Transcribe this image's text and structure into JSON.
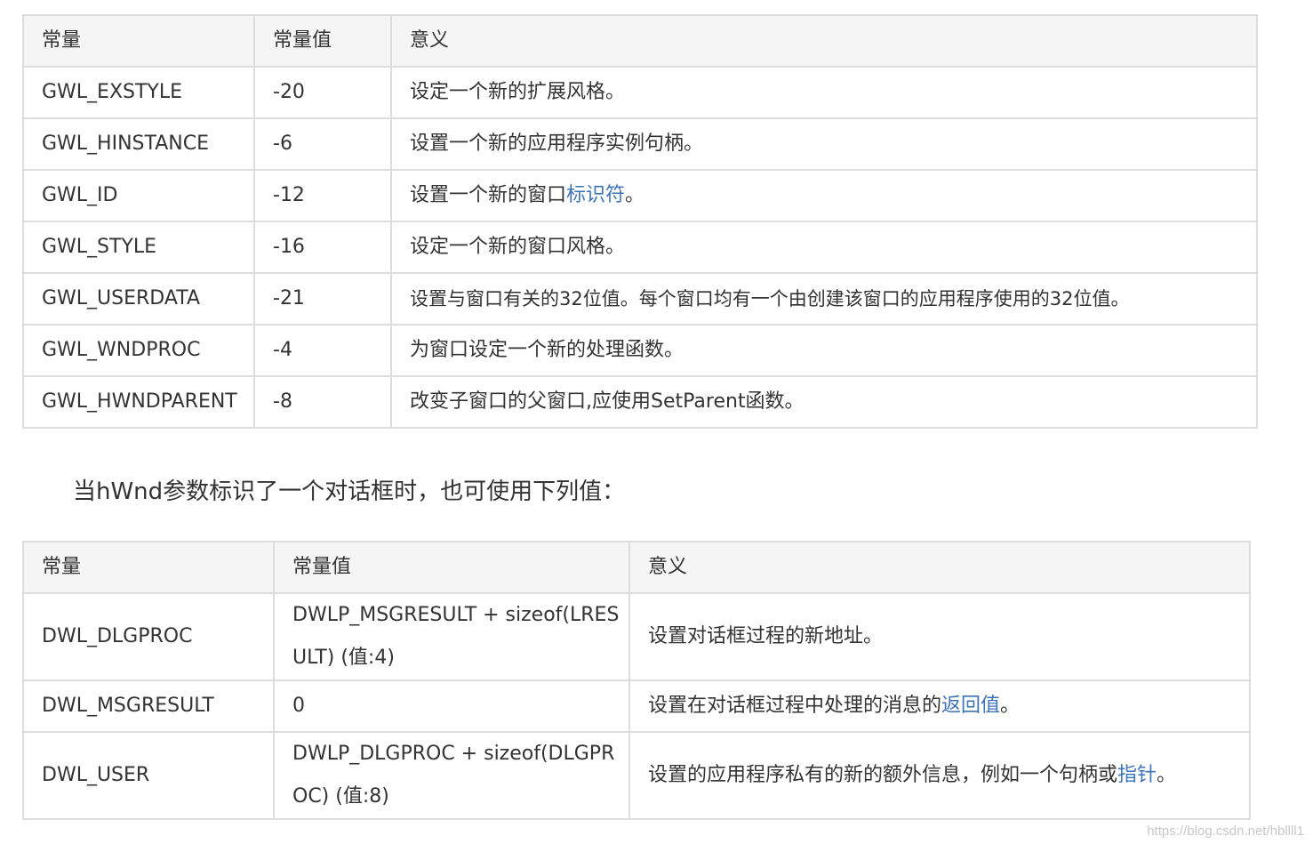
{
  "table1": {
    "headers": [
      "常量",
      "常量值",
      "意义"
    ],
    "rows": [
      {
        "name": "GWL_EXSTYLE",
        "value": "-20",
        "desc": "设定一个新的扩展风格。"
      },
      {
        "name": "GWL_HINSTANCE",
        "value": "-6",
        "desc": "设置一个新的应用程序实例句柄。"
      },
      {
        "name": "GWL_ID",
        "value": "-12",
        "desc_pre": "设置一个新的窗口",
        "desc_link": "标识符",
        "desc_post": "。"
      },
      {
        "name": "GWL_STYLE",
        "value": "-16",
        "desc": "设定一个新的窗口风格。"
      },
      {
        "name": "GWL_USERDATA",
        "value": "-21",
        "desc": "设置与窗口有关的32位值。每个窗口均有一个由创建该窗口的应用程序使用的32位值。"
      },
      {
        "name": "GWL_WNDPROC",
        "value": "-4",
        "desc": "为窗口设定一个新的处理函数。"
      },
      {
        "name": "GWL_HWNDPARENT",
        "value": "-8",
        "desc": "改变子窗口的父窗口,应使用SetParent函数。"
      }
    ]
  },
  "note": "当hWnd参数标识了一个对话框时，也可使用下列值：",
  "table2": {
    "headers": [
      "常量",
      "常量值",
      "意义"
    ],
    "rows": [
      {
        "name": "DWL_DLGPROC",
        "value": "DWLP_MSGRESULT + sizeof(LRESULT) (值:4)",
        "desc": "设置对话框过程的新地址。"
      },
      {
        "name": "DWL_MSGRESULT",
        "value": "0",
        "desc_pre": "设置在对话框过程中处理的消息的",
        "desc_link": "返回值",
        "desc_post": "。"
      },
      {
        "name": "DWL_USER",
        "value": "DWLP_DLGPROC + sizeof(DLGPROC) (值:8)",
        "desc_pre": "设置的应用程序私有的新的额外信息，例如一个句柄或",
        "desc_link": "指针",
        "desc_post": "。"
      }
    ]
  },
  "watermark": "https://blog.csdn.net/hbllll1",
  "colors": {
    "link": "#3d73b9",
    "border": "#dddddd",
    "header_bg": "#f5f5f5",
    "text": "#333333"
  }
}
